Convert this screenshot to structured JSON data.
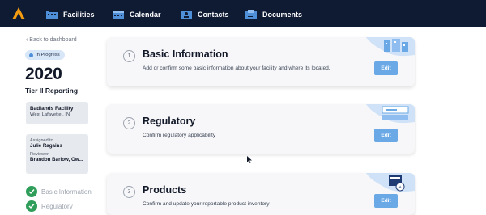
{
  "nav": {
    "items": [
      {
        "label": "Facilities",
        "icon": "building-icon"
      },
      {
        "label": "Calendar",
        "icon": "calendar-icon"
      },
      {
        "label": "Contacts",
        "icon": "contacts-icon"
      },
      {
        "label": "Documents",
        "icon": "documents-icon"
      }
    ],
    "logo_color": "#f39c12",
    "bar_color": "#0f1a33"
  },
  "sidebar": {
    "back_link": "‹ Back to dashboard",
    "status": "In Progress",
    "year": "2020",
    "report_type": "Tier II Reporting",
    "facility": {
      "name": "Badlands Facility",
      "location": "West Lafayette , IN"
    },
    "assignment": {
      "assigned_label": "Assigned to",
      "assigned_value": "Julie Ragains",
      "reviewer_label": "Reviewer",
      "reviewer_value": "Brandon Barlow, Ow..."
    },
    "steps": [
      {
        "label": "Basic Information",
        "done": true
      },
      {
        "label": "Regulatory",
        "done": true
      }
    ]
  },
  "sections": [
    {
      "number": "1",
      "title": "Basic Information",
      "description": "Add or confirm some basic information about your facility and where its located.",
      "edit_label": "Edit"
    },
    {
      "number": "2",
      "title": "Regulatory",
      "description": "Confirm regulatory applicability",
      "edit_label": "Edit"
    },
    {
      "number": "3",
      "title": "Products",
      "description": "Confirm and update your reportable product inventory",
      "edit_label": "Edit"
    }
  ],
  "colors": {
    "accent": "#6aa9e6",
    "success": "#2f9e5a",
    "status_bg": "#d8e7f8"
  }
}
